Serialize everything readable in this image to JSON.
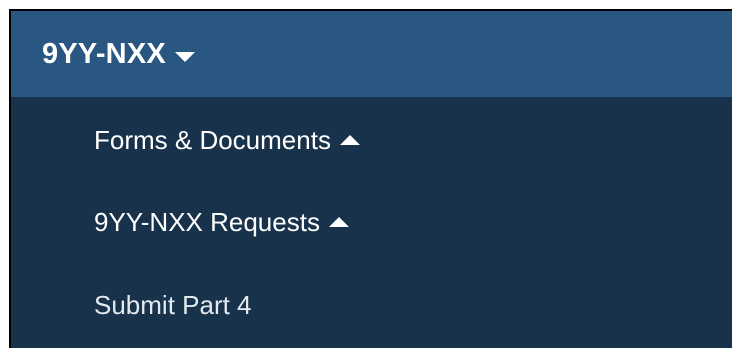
{
  "menu": {
    "title": "9YY-NXX",
    "title_icon": "caret-down-icon",
    "items": [
      {
        "label": "Forms & Documents",
        "icon": "caret-up-icon"
      },
      {
        "label": "9YY-NXX Requests",
        "icon": "caret-up-icon"
      },
      {
        "label": "Submit Part 4"
      }
    ]
  },
  "colors": {
    "header_bg": "#2a5782",
    "menu_bg": "#18324b",
    "text": "#ffffff"
  }
}
